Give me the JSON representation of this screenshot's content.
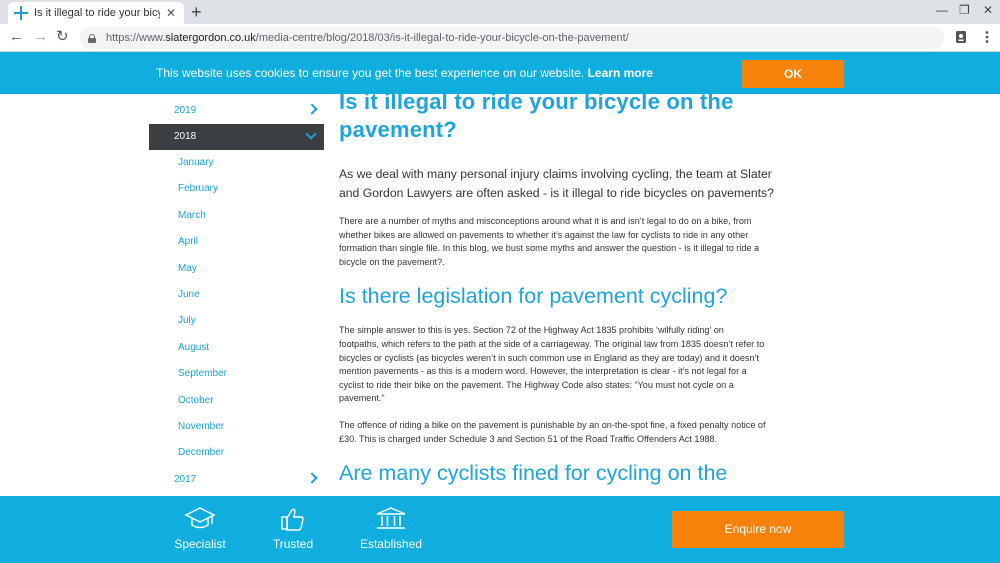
{
  "browser": {
    "tab_title": "Is it illegal to ride your bicycle on",
    "tab_close": "✕",
    "new_tab": "+",
    "window_controls": [
      "—",
      "❐",
      "✕"
    ],
    "nav": {
      "back": "←",
      "forward": "→",
      "reload": "↻"
    },
    "url_prefix": "https://www.",
    "url_domain": "slatergordon.co.uk",
    "url_path": "/media-centre/blog/2018/03/is-it-illegal-to-ride-your-bicycle-on-the-pavement/",
    "toolbar_icons": [
      "passport-icon",
      "menu-dots-icon"
    ]
  },
  "cookie_banner": {
    "text": "This website uses cookies to ensure you get the best experience on our website.",
    "link": "Learn more",
    "ok": "OK",
    "color": "#0faedf",
    "button_color": "#f7820b"
  },
  "sidebar": {
    "years": [
      {
        "label": "2019",
        "expanded": false
      },
      {
        "label": "2018",
        "expanded": true
      },
      {
        "label": "2017",
        "expanded": false
      }
    ],
    "months": [
      "January",
      "February",
      "March",
      "April",
      "May",
      "June",
      "July",
      "August",
      "September",
      "October",
      "November",
      "December"
    ]
  },
  "article": {
    "title_line1": "Is it illegal to ride your bicycle on the",
    "title_line2": "pavement?",
    "lead_line1": "As we deal with many personal injury claims involving cycling, the team at Slater",
    "lead_line2": "and Gordon Lawyers are often asked - is it illegal to ride bicycles on pavements?",
    "p1": [
      "There are a number of myths and misconceptions around what it is and isn’t legal to do on a bike, from",
      "whether bikes are allowed on pavements to whether it’s against the law for cyclists to ride in any other",
      "formation than single file. In this blog, we bust some myths and answer the question - is it illegal to ride a",
      "bicycle on the pavement?."
    ],
    "h2_1": "Is there legislation for pavement cycling?",
    "p2": [
      "The simple answer to this is yes. Section 72 of the Highway Act 1835 prohibits ‘wilfully riding’ on",
      "footpaths, which refers to the path at the side of a carriageway. The original law from 1835 doesn’t refer to",
      "bicycles or cyclists (as bicycles weren’t in such common use in England as they are today) and it doesn’t",
      "mention pavements - as this is a modern word. However, the interpretation is clear - it’s not legal for a",
      "cyclist to ride their bike on the pavement. The Highway Code also states: “You must not cycle on a",
      "pavement.”"
    ],
    "p3": [
      "The offence of riding a bike on the pavement is punishable by an on-the-spot fine, a fixed penalty notice of",
      "£30. This is charged under Schedule 3 and Section 51 of the Road Traffic Offenders Act 1988."
    ],
    "h2_2": "Are many cyclists fined for cycling on the"
  },
  "banner": {
    "features": [
      {
        "label": "Specialist",
        "icon": "graduation-cap-icon"
      },
      {
        "label": "Trusted",
        "icon": "thumbs-up-icon"
      },
      {
        "label": "Established",
        "icon": "bank-building-icon"
      }
    ],
    "enquire": "Enquire now"
  }
}
